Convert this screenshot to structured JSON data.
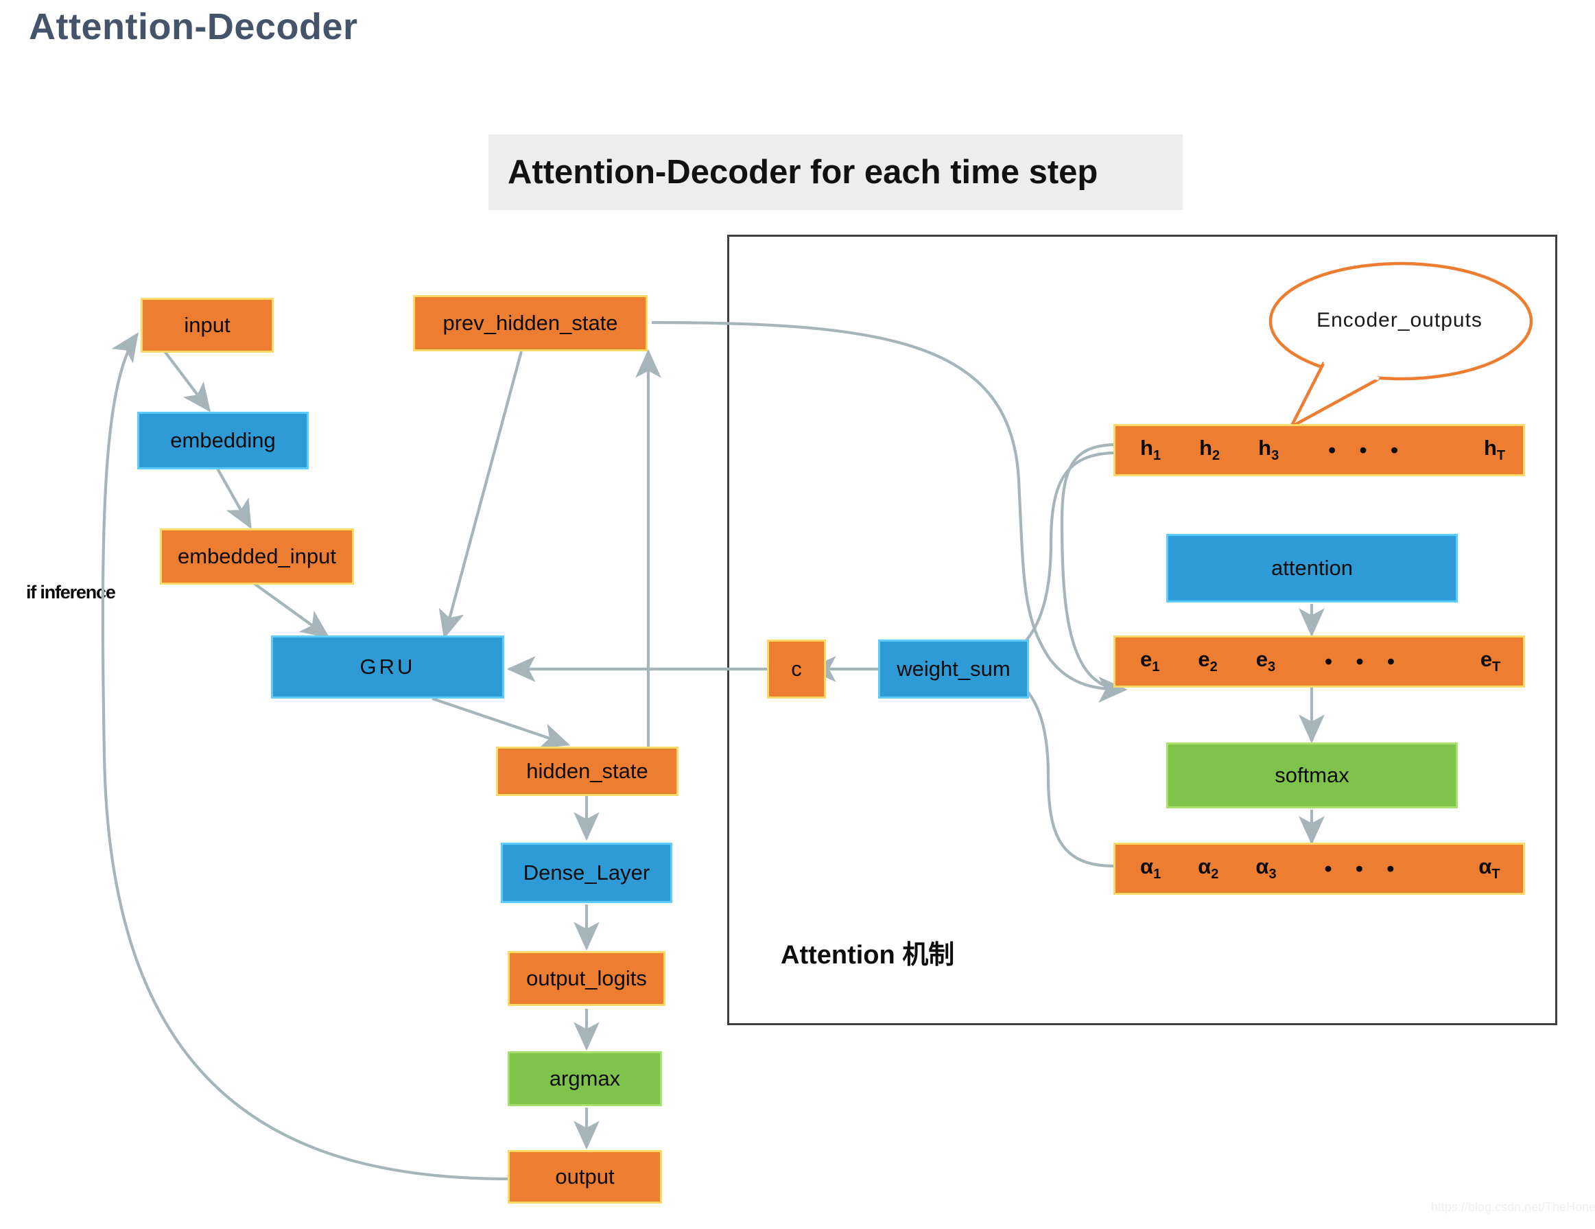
{
  "page": {
    "title": "Attention-Decoder",
    "watermark": "https://blog.csdn.net/TheHonestBob"
  },
  "banner": {
    "text": "Attention-Decoder for each time step"
  },
  "attention_frame": {
    "caption": "Attention 机制"
  },
  "labels": {
    "if_inference": "if inference"
  },
  "callout": {
    "text": "Encoder_outputs"
  },
  "colors": {
    "orange_fill": "#ed7d31",
    "orange_border": "#ffd966",
    "blue_fill": "#2e9bd6",
    "blue_border": "#5ecbff",
    "green_fill": "#80c34c",
    "green_border": "#a9e06b",
    "banner_bg": "#ededed",
    "arrow": "#a6b5b9",
    "frame": "#3f3f3f",
    "title": "#44546a"
  },
  "nodes": {
    "input": "input",
    "embedding": "embedding",
    "embedded_input": "embedded_input",
    "prev_hidden_state": "prev_hidden_state",
    "gru": "GRU",
    "hidden_state": "hidden_state",
    "dense_layer": "Dense_Layer",
    "output_logits": "output_logits",
    "argmax": "argmax",
    "output": "output",
    "c": "c",
    "weight_sum": "weight_sum",
    "attention": "attention",
    "softmax": "softmax"
  },
  "vectors": {
    "h": {
      "items": [
        "h",
        "h",
        "h"
      ],
      "subs": [
        "1",
        "2",
        "3"
      ],
      "dots": "• • •",
      "last": "h",
      "last_sub": "T"
    },
    "e": {
      "items": [
        "e",
        "e",
        "e"
      ],
      "subs": [
        "1",
        "2",
        "3"
      ],
      "dots": "• • •",
      "last": "e",
      "last_sub": "T"
    },
    "alpha": {
      "items": [
        "α",
        "α",
        "α"
      ],
      "subs": [
        "1",
        "2",
        "3"
      ],
      "dots": "• • •",
      "last": "α",
      "last_sub": "T"
    }
  }
}
